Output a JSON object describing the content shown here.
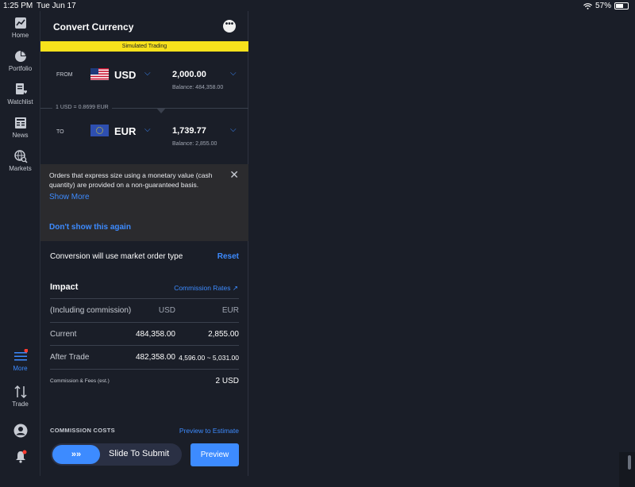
{
  "status": {
    "time": "1:25 PM",
    "date": "Tue Jun 17",
    "battery": "57%"
  },
  "sidebar": {
    "items": [
      {
        "label": "Home",
        "icon": "home-chart-icon"
      },
      {
        "label": "Portfolio",
        "icon": "pie-chart-icon"
      },
      {
        "label": "Watchlist",
        "icon": "watchlist-icon"
      },
      {
        "label": "News",
        "icon": "news-icon"
      },
      {
        "label": "Markets",
        "icon": "globe-search-icon"
      },
      {
        "label": "More",
        "icon": "menu-icon"
      },
      {
        "label": "Trade",
        "icon": "trade-arrows-icon"
      }
    ]
  },
  "header": {
    "title": "Convert Currency",
    "more": "•••"
  },
  "banner": "Simulated Trading",
  "from": {
    "label": "FROM",
    "code": "USD",
    "amount": "2,000.00",
    "balance": "Balance: 484,358.00"
  },
  "rate": "1 USD = 0.8699 EUR",
  "to": {
    "label": "TO",
    "code": "EUR",
    "amount": "1,739.77",
    "balance": "Balance: 2,855.00"
  },
  "notice": {
    "message": "Orders that express size using a monetary value (cash quantity) are provided on a non-guaranteed basis.",
    "show_more": "Show More",
    "dont_show": "Don't show this again",
    "close": "✕"
  },
  "conversion": {
    "text": "Conversion will use market order type",
    "reset": "Reset"
  },
  "impact": {
    "title": "Impact",
    "commission_rates": "Commission Rates ↗",
    "rows": [
      [
        "(Including commission)",
        "USD",
        "EUR"
      ],
      [
        "Current",
        "484,358.00",
        "2,855.00"
      ],
      [
        "After Trade",
        "482,358.00",
        "4,596.00 ~ 5,031.00"
      ],
      [
        "Commission & Fees (est.)",
        "",
        "2 USD"
      ]
    ]
  },
  "costs": {
    "label": "COMMISSION COSTS",
    "link": "Preview to Estimate"
  },
  "actions": {
    "slide": "Slide To Submit",
    "slide_knob": "»»",
    "preview": "Preview"
  },
  "colors": {
    "accent": "#3d8bff",
    "banner": "#f7e11c",
    "background": "#1a1e28",
    "notification": "#ff3b30"
  }
}
